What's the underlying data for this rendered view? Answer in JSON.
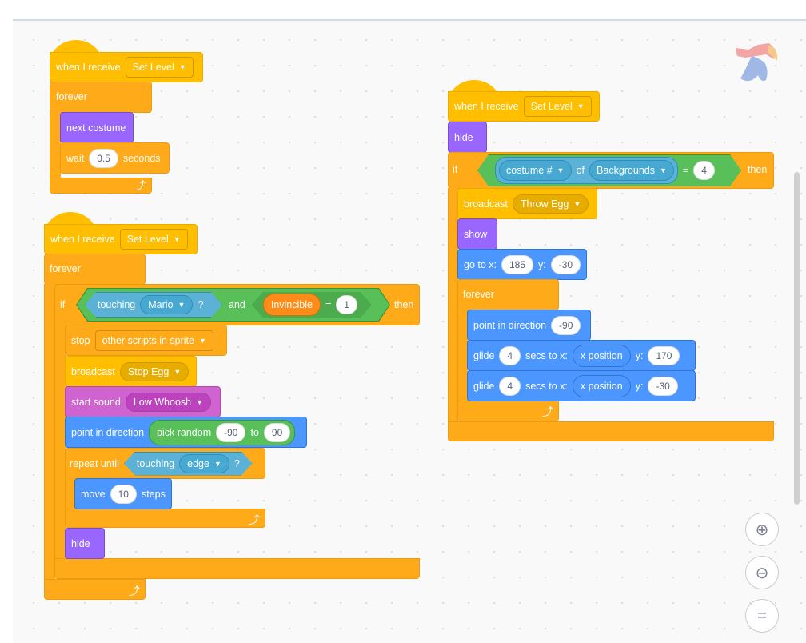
{
  "s1": {
    "hat": "when I receive",
    "msg": "Set Level",
    "forever": "forever",
    "next": "next costume",
    "wait": "wait",
    "wait_val": "0.5",
    "seconds": "seconds"
  },
  "s2": {
    "hat": "when I receive",
    "msg": "Set Level",
    "forever": "forever",
    "if": "if",
    "then": "then",
    "touching": "touching",
    "mario": "Mario",
    "q": "?",
    "and": "and",
    "invincible": "Invincible",
    "eq": "=",
    "one": "1",
    "stop": "stop",
    "stop_opt": "other scripts in sprite",
    "broadcast": "broadcast",
    "stop_egg": "Stop Egg",
    "start_sound": "start sound",
    "sound": "Low Whoosh",
    "point": "point in direction",
    "pick": "pick random",
    "from": "-90",
    "to": "to",
    "to_val": "90",
    "repeat": "repeat until",
    "edge": "edge",
    "move": "move",
    "steps_val": "10",
    "steps": "steps",
    "hide": "hide"
  },
  "s3": {
    "hat": "when I receive",
    "msg": "Set Level",
    "hide": "hide",
    "if": "if",
    "costume": "costume #",
    "of": "of",
    "backgrounds": "Backgrounds",
    "eq": "=",
    "four": "4",
    "then": "then",
    "broadcast": "broadcast",
    "throw_egg": "Throw Egg",
    "show": "show",
    "goto": "go to x:",
    "x": "185",
    "y_label": "y:",
    "y": "-30",
    "forever": "forever",
    "point": "point in direction",
    "dir": "-90",
    "glide": "glide",
    "secs_val": "4",
    "secs": "secs to x:",
    "xpos": "x position",
    "y1": "170",
    "y2": "-30"
  },
  "zoom": {
    "in": "zoom-in",
    "out": "zoom-out",
    "reset": "="
  },
  "colors": {
    "events": "#FFBF00",
    "control": "#FFAB19",
    "looks": "#9966FF",
    "sound": "#CF63CF",
    "motion": "#4C97FF",
    "sensing": "#5CB1D6",
    "operators": "#59C059",
    "variables": "#FF8C1A"
  }
}
